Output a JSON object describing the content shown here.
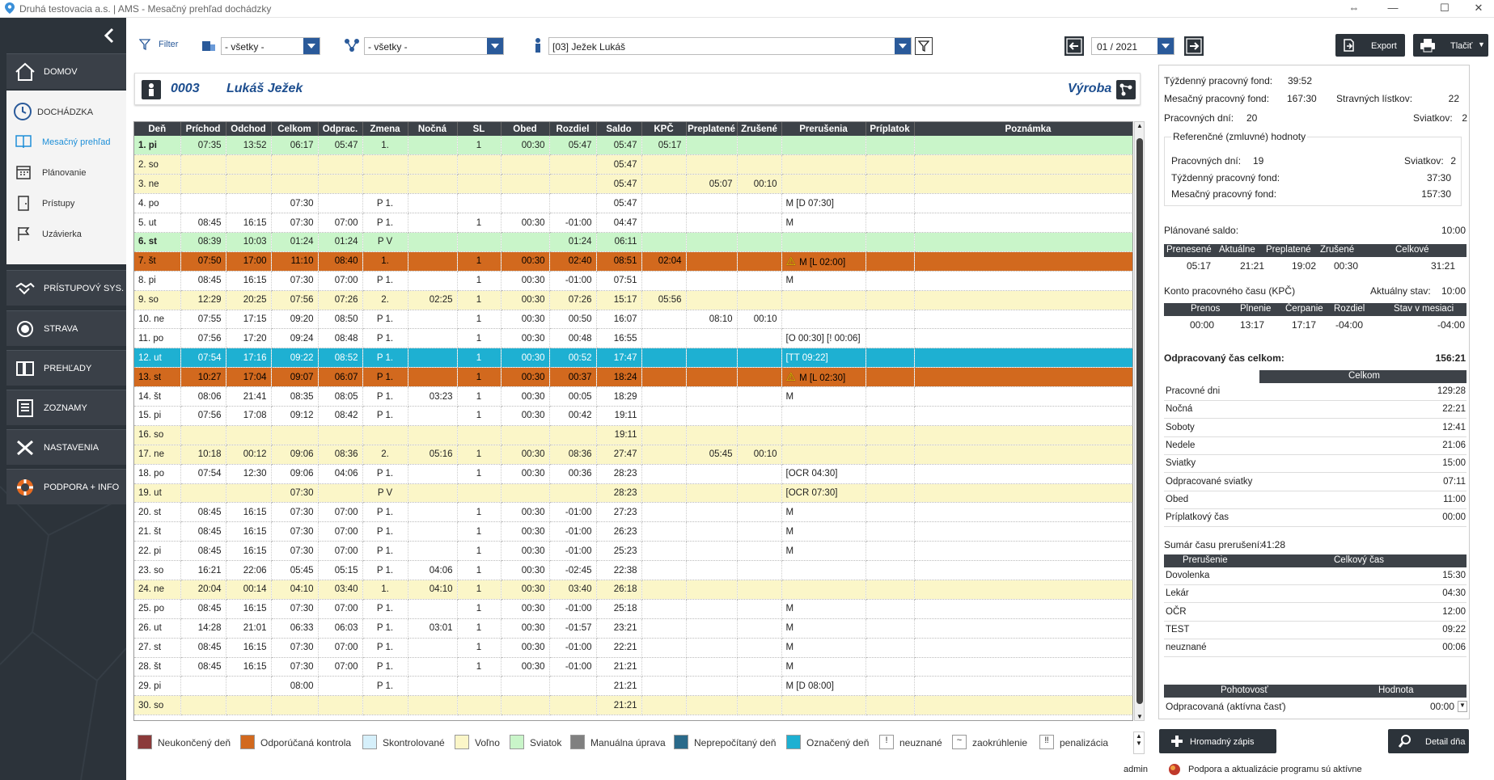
{
  "window": {
    "title": "Druhá testovacia a.s. | AMS - Mesačný prehľad dochádzky"
  },
  "sidebar": {
    "home": "DOMOV",
    "dochadzka": "DOCHÁDZKA",
    "sub": [
      "Mesačný prehľad",
      "Plánovanie",
      "Prístupy",
      "Uzávierka"
    ],
    "items": [
      "PRÍSTUPOVÝ SYS.",
      "STRAVA",
      "PREHĽADY",
      "ZOZNAMY",
      "NASTAVENIA",
      "PODPORA + INFO"
    ]
  },
  "toolbar": {
    "filter": "Filter",
    "combo1": "- všetky -",
    "combo2": "- všetky -",
    "employee": "[03] Ježek Lukáš",
    "month": "01 / 2021",
    "export": "Export",
    "print": "Tlačiť"
  },
  "header": {
    "num": "0003",
    "name": "Lukáš Ježek",
    "dept": "Výroba"
  },
  "columns": [
    "Deň",
    "Príchod",
    "Odchod",
    "Celkom",
    "Odprac.",
    "Zmena",
    "Nočná",
    "SL",
    "Obed",
    "Rozdiel",
    "Saldo",
    "KPČ",
    "Preplatené",
    "Zrušené",
    "Prerušenia",
    "Príplatok",
    "Poznámka"
  ],
  "rows": [
    {
      "t": "sv",
      "c": [
        "1. pi",
        "07:35",
        "13:52",
        "06:17",
        "05:47",
        "1.",
        "",
        "1",
        "00:30",
        "05:47",
        "05:47",
        "05:17",
        "",
        "",
        "",
        "",
        ""
      ]
    },
    {
      "t": "vo",
      "c": [
        "2. so",
        "",
        "",
        "",
        "",
        "",
        "",
        "",
        "",
        "",
        "05:47",
        "",
        "",
        "",
        "",
        "",
        ""
      ]
    },
    {
      "t": "vo",
      "c": [
        "3. ne",
        "",
        "",
        "",
        "",
        "",
        "",
        "",
        "",
        "",
        "05:47",
        "",
        "05:07",
        "00:10",
        "",
        "",
        ""
      ]
    },
    {
      "t": "wk",
      "c": [
        "4. po",
        "",
        "",
        "07:30",
        "",
        "P 1.",
        "",
        "",
        "",
        "",
        "05:47",
        "",
        "",
        "",
        "M [D 07:30]",
        "",
        ""
      ]
    },
    {
      "t": "wk",
      "c": [
        "5. ut",
        "08:45",
        "16:15",
        "07:30",
        "07:00",
        "P 1.",
        "",
        "1",
        "00:30",
        "-01:00",
        "04:47",
        "",
        "",
        "",
        "M",
        "",
        ""
      ]
    },
    {
      "t": "sv",
      "c": [
        "6. st",
        "08:39",
        "10:03",
        "01:24",
        "01:24",
        "P V",
        "",
        "",
        "",
        "01:24",
        "06:11",
        "",
        "",
        "",
        "",
        "",
        ""
      ]
    },
    {
      "t": "od",
      "c": [
        "7. št",
        "07:50",
        "17:00",
        "11:10",
        "08:40",
        "1.",
        "",
        "1",
        "00:30",
        "02:40",
        "08:51",
        "02:04",
        "",
        "",
        "⚠ M [L 02:00]",
        "",
        ""
      ]
    },
    {
      "t": "wk",
      "c": [
        "8. pi",
        "08:45",
        "16:15",
        "07:30",
        "07:00",
        "P 1.",
        "",
        "1",
        "00:30",
        "-01:00",
        "07:51",
        "",
        "",
        "",
        "M",
        "",
        ""
      ]
    },
    {
      "t": "vo",
      "c": [
        "9. so",
        "12:29",
        "20:25",
        "07:56",
        "07:26",
        "2.",
        "02:25",
        "1",
        "00:30",
        "07:26",
        "15:17",
        "05:56",
        "",
        "",
        "",
        "",
        ""
      ]
    },
    {
      "t": "wk",
      "c": [
        "10. ne",
        "07:55",
        "17:15",
        "09:20",
        "08:50",
        "P 1.",
        "",
        "1",
        "00:30",
        "00:50",
        "16:07",
        "",
        "08:10",
        "00:10",
        "",
        "",
        ""
      ]
    },
    {
      "t": "wk",
      "c": [
        "11. po",
        "07:56",
        "17:20",
        "09:24",
        "08:48",
        "P 1.",
        "",
        "1",
        "00:30",
        "00:48",
        "16:55",
        "",
        "",
        "",
        "[O 00:30] [! 00:06]",
        "",
        ""
      ]
    },
    {
      "t": "oz",
      "c": [
        "12. ut",
        "07:54",
        "17:16",
        "09:22",
        "08:52",
        "P 1.",
        "",
        "1",
        "00:30",
        "00:52",
        "17:47",
        "",
        "",
        "",
        "[TT 09:22]",
        "",
        ""
      ]
    },
    {
      "t": "od",
      "c": [
        "13. st",
        "10:27",
        "17:04",
        "09:07",
        "06:07",
        "P 1.",
        "",
        "1",
        "00:30",
        "00:37",
        "18:24",
        "",
        "",
        "",
        "⚠ M [L 02:30]",
        "",
        ""
      ]
    },
    {
      "t": "wk",
      "c": [
        "14. št",
        "08:06",
        "21:41",
        "08:35",
        "08:05",
        "P 1.",
        "03:23",
        "1",
        "00:30",
        "00:05",
        "18:29",
        "",
        "",
        "",
        "M",
        "",
        ""
      ]
    },
    {
      "t": "wk",
      "c": [
        "15. pi",
        "07:56",
        "17:08",
        "09:12",
        "08:42",
        "P 1.",
        "",
        "1",
        "00:30",
        "00:42",
        "19:11",
        "",
        "",
        "",
        "",
        "",
        ""
      ]
    },
    {
      "t": "vo",
      "c": [
        "16. so",
        "",
        "",
        "",
        "",
        "",
        "",
        "",
        "",
        "",
        "19:11",
        "",
        "",
        "",
        "",
        "",
        ""
      ]
    },
    {
      "t": "vo",
      "c": [
        "17. ne",
        "10:18",
        "00:12",
        "09:06",
        "08:36",
        "2.",
        "05:16",
        "1",
        "00:30",
        "08:36",
        "27:47",
        "",
        "05:45",
        "00:10",
        "",
        "",
        ""
      ]
    },
    {
      "t": "wk",
      "c": [
        "18. po",
        "07:54",
        "12:30",
        "09:06",
        "04:06",
        "P 1.",
        "",
        "1",
        "00:30",
        "00:36",
        "28:23",
        "",
        "",
        "",
        "[OCR 04:30]",
        "",
        ""
      ]
    },
    {
      "t": "vo",
      "c": [
        "19. ut",
        "",
        "",
        "07:30",
        "",
        "P V",
        "",
        "",
        "",
        "",
        "28:23",
        "",
        "",
        "",
        "[OCR 07:30]",
        "",
        ""
      ]
    },
    {
      "t": "wk",
      "c": [
        "20. st",
        "08:45",
        "16:15",
        "07:30",
        "07:00",
        "P 1.",
        "",
        "1",
        "00:30",
        "-01:00",
        "27:23",
        "",
        "",
        "",
        "M",
        "",
        ""
      ]
    },
    {
      "t": "wk",
      "c": [
        "21. št",
        "08:45",
        "16:15",
        "07:30",
        "07:00",
        "P 1.",
        "",
        "1",
        "00:30",
        "-01:00",
        "26:23",
        "",
        "",
        "",
        "M",
        "",
        ""
      ]
    },
    {
      "t": "wk",
      "c": [
        "22. pi",
        "08:45",
        "16:15",
        "07:30",
        "07:00",
        "P 1.",
        "",
        "1",
        "00:30",
        "-01:00",
        "25:23",
        "",
        "",
        "",
        "M",
        "",
        ""
      ]
    },
    {
      "t": "wk",
      "c": [
        "23. so",
        "16:21",
        "22:06",
        "05:45",
        "05:15",
        "P 1.",
        "04:06",
        "1",
        "00:30",
        "-02:45",
        "22:38",
        "",
        "",
        "",
        "",
        "",
        ""
      ]
    },
    {
      "t": "vo",
      "c": [
        "24. ne",
        "20:04",
        "00:14",
        "04:10",
        "03:40",
        "1.",
        "04:10",
        "1",
        "00:30",
        "03:40",
        "26:18",
        "",
        "",
        "",
        "",
        "",
        ""
      ]
    },
    {
      "t": "wk",
      "c": [
        "25. po",
        "08:45",
        "16:15",
        "07:30",
        "07:00",
        "P 1.",
        "",
        "1",
        "00:30",
        "-01:00",
        "25:18",
        "",
        "",
        "",
        "M",
        "",
        ""
      ]
    },
    {
      "t": "wk",
      "c": [
        "26. ut",
        "14:28",
        "21:01",
        "06:33",
        "06:03",
        "P 1.",
        "03:01",
        "1",
        "00:30",
        "-01:57",
        "23:21",
        "",
        "",
        "",
        "M",
        "",
        ""
      ]
    },
    {
      "t": "wk",
      "c": [
        "27. st",
        "08:45",
        "16:15",
        "07:30",
        "07:00",
        "P 1.",
        "",
        "1",
        "00:30",
        "-01:00",
        "22:21",
        "",
        "",
        "",
        "M",
        "",
        ""
      ]
    },
    {
      "t": "wk",
      "c": [
        "28. št",
        "08:45",
        "16:15",
        "07:30",
        "07:00",
        "P 1.",
        "",
        "1",
        "00:30",
        "-01:00",
        "21:21",
        "",
        "",
        "",
        "M",
        "",
        ""
      ]
    },
    {
      "t": "wk",
      "c": [
        "29. pi",
        "",
        "",
        "08:00",
        "",
        "P 1.",
        "",
        "",
        "",
        "",
        "21:21",
        "",
        "",
        "",
        "M [D 08:00]",
        "",
        ""
      ]
    },
    {
      "t": "vo",
      "c": [
        "30. so",
        "",
        "",
        "",
        "",
        "",
        "",
        "",
        "",
        "",
        "21:21",
        "",
        "",
        "",
        "",
        "",
        ""
      ]
    }
  ],
  "legend": [
    {
      "label": "Neukončený deň",
      "color": "#8b3a3a"
    },
    {
      "label": "Odporúčaná kontrola",
      "color": "#d2691e"
    },
    {
      "label": "Skontrolované",
      "color": "#d6f0fb"
    },
    {
      "label": "Voľno",
      "color": "#fbf6c8"
    },
    {
      "label": "Sviatok",
      "color": "#c9f5c9"
    },
    {
      "label": "Manuálna úprava",
      "color": "#808080"
    },
    {
      "label": "Neprepočítaný deň",
      "color": "#2a6a8a"
    },
    {
      "label": "Označený deň",
      "color": "#1eb0d2"
    },
    {
      "label": "neuznané",
      "sym": "!"
    },
    {
      "label": "zaokrúhlenie",
      "sym": "~"
    },
    {
      "label": "penalizácia",
      "sym": "‼"
    }
  ],
  "summary": {
    "weekly_label": "Týždenný pracovný fond:",
    "weekly": "39:52",
    "monthly_label": "Mesačný pracovný fond:",
    "monthly": "167:30",
    "meal_label": "Stravných lístkov:",
    "meal": "22",
    "workdays_label": "Pracovných dní:",
    "workdays": "20",
    "holidays_label": "Sviatkov:",
    "holidays": "2",
    "ref_title": "Referenčné (zmluvné) hodnoty",
    "ref_workdays_label": "Pracovných dní:",
    "ref_workdays": "19",
    "ref_holidays_label": "Sviatkov:",
    "ref_holidays": "2",
    "ref_weekly_label": "Týždenný pracovný fond:",
    "ref_weekly": "37:30",
    "ref_monthly_label": "Mesačný pracovný fond:",
    "ref_monthly": "157:30",
    "planned_label": "Plánované saldo:",
    "planned": "10:00",
    "saldo_headers": [
      "Prenesené",
      "Aktuálne",
      "Preplatené",
      "Zrušené",
      "Celkové"
    ],
    "saldo_values": [
      "05:17",
      "21:21",
      "19:02",
      "00:30",
      "31:21"
    ],
    "kpc_label": "Konto pracovného času (KPČ)",
    "kpc_state_label": "Aktuálny stav:",
    "kpc_state": "10:00",
    "kpc_headers": [
      "Prenos",
      "Plnenie",
      "Čerpanie",
      "Rozdiel",
      "Stav v mesiaci"
    ],
    "kpc_values": [
      "00:00",
      "13:17",
      "17:17",
      "-04:00",
      "-04:00"
    ],
    "worked_label": "Odpracovaný čas celkom:",
    "worked": "156:21",
    "worked_header": "Celkom",
    "worked_rows": [
      [
        "Pracovné dni",
        "129:28"
      ],
      [
        "Nočná",
        "22:21"
      ],
      [
        "Soboty",
        "12:41"
      ],
      [
        "Nedele",
        "21:06"
      ],
      [
        "Sviatky",
        "15:00"
      ],
      [
        "Odpracované sviatky",
        "07:11"
      ],
      [
        "Obed",
        "11:00"
      ],
      [
        "Príplatkový čas",
        "00:00"
      ]
    ],
    "interrupt_label": "Sumár času prerušení:",
    "interrupt": "41:28",
    "interrupt_headers": [
      "Prerušenie",
      "Celkový čas"
    ],
    "interrupt_rows": [
      [
        "Dovolenka",
        "15:30"
      ],
      [
        "Lekár",
        "04:30"
      ],
      [
        "OČR",
        "12:00"
      ],
      [
        "TEST",
        "09:22"
      ],
      [
        "neuznané",
        "00:06"
      ]
    ],
    "standby_headers": [
      "Pohotovosť",
      "Hodnota"
    ],
    "standby_rows": [
      [
        "Odpracovaná (aktívna časť)",
        "00:00"
      ]
    ]
  },
  "actions": {
    "bulk": "Hromadný zápis",
    "detail": "Detail dňa"
  },
  "status": {
    "user": "admin",
    "message": "Podpora a aktualizácie programu sú aktívne"
  }
}
